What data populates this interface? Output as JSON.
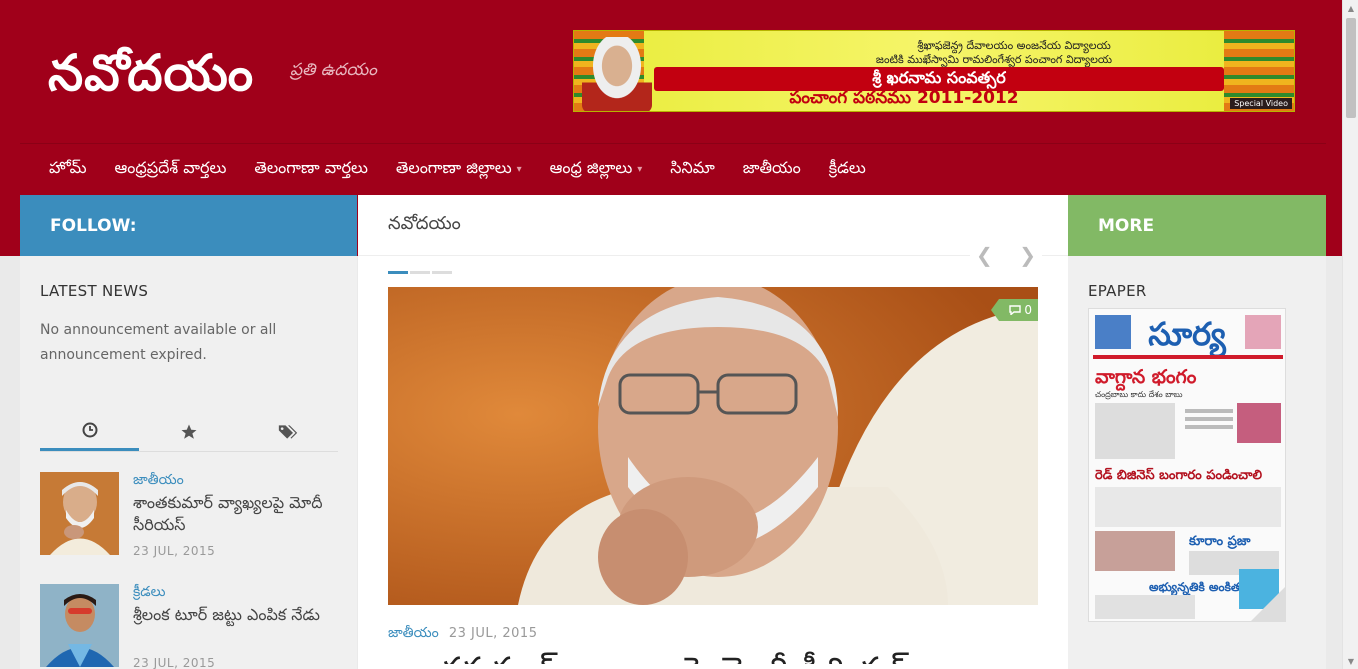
{
  "site": {
    "title": "నవోదయం",
    "tagline": "ప్రతి ఉదయం"
  },
  "banner": {
    "line1": "శ్రీఖాఫజెన్ద్ర దేవాలయం అంజనేయ విద్యాలయ",
    "line2": "జంటికి ముఖేస్వామి రామలింగేశ్వర పంచాంగ విద్యాలయ",
    "strip1": "శ్రీ ఖరనామ సంవత్సర",
    "strip2": "పంచాంగ పఠనము 2011-2012",
    "badge": "Special Video"
  },
  "nav": {
    "items": [
      {
        "label": "హోమ్",
        "dropdown": false
      },
      {
        "label": "ఆంధ్రప్రదేశ్ వార్తలు",
        "dropdown": false
      },
      {
        "label": "తెలంగాణా వార్తలు",
        "dropdown": false
      },
      {
        "label": "తెలంగాణా జిల్లాలు",
        "dropdown": true
      },
      {
        "label": "ఆంధ్ర జిల్లాలు",
        "dropdown": true
      },
      {
        "label": "సినిమా",
        "dropdown": false
      },
      {
        "label": "జాతీయం",
        "dropdown": false
      },
      {
        "label": "క్రీడలు",
        "dropdown": false
      }
    ]
  },
  "follow_label": "FOLLOW:",
  "more_label": "MORE",
  "main": {
    "heading": "నవోదయం",
    "comment_count": "0",
    "featured": {
      "category": "జాతీయం",
      "date": "23 JUL, 2015",
      "title": "శాంతకుమార్ వ్యాఖ్యలపై మోదీ సీరియస్"
    }
  },
  "left": {
    "widget_title": "LATEST NEWS",
    "announcement": "No announcement available or all announcement expired.",
    "posts": [
      {
        "category": "జాతీయం",
        "title": "శాంతకుమార్ వ్యాఖ్యలపై మోదీ సీరియస్",
        "date": "23 JUL, 2015"
      },
      {
        "category": "క్రీడలు",
        "title": "శ్రీలంక టూర్ జట్టు ఎంపిక నేడు",
        "date": "23 JUL, 2015"
      }
    ]
  },
  "right": {
    "widget_title": "EPAPER",
    "paper": {
      "masthead": "సూర్య",
      "headline1": "వాగ్దాన భంగం",
      "sub1": "చంద్రబాబు కాదు దేశం బాబు",
      "headline2": "రెడ్ బిజినెస్ బంగారం పండించాలి",
      "headline3": "కూరాం ప్రజా",
      "headline4": "అభ్యున్నతికి అంకితం"
    }
  },
  "colors": {
    "brand": "#a0001a",
    "follow": "#3b8dbd",
    "more": "#82b965"
  }
}
